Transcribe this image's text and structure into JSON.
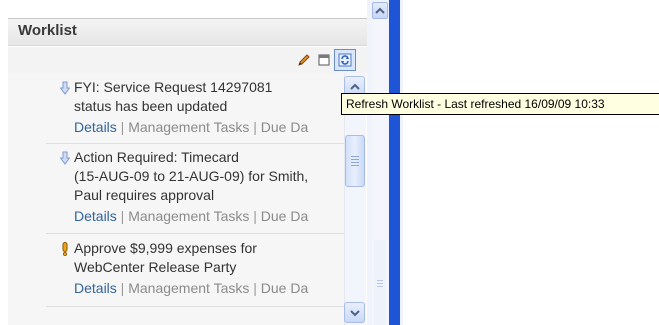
{
  "worklist": {
    "title": "Worklist",
    "toolbar": {
      "edit_icon": "pencil-icon",
      "window_icon": "window-icon",
      "refresh_icon": "refresh-icon"
    },
    "tooltip": "Refresh Worklist - Last refreshed 16/09/09 10:33",
    "items": [
      {
        "icon": "arrow-down-icon",
        "lines": [
          "FYI: Service Request 14297081",
          "status has been updated"
        ],
        "links": {
          "details": "Details",
          "sep1": " | ",
          "management": "Management Tasks",
          "sep2": " | ",
          "due": "Due Da"
        }
      },
      {
        "icon": "arrow-down-icon",
        "lines": [
          "Action Required: Timecard",
          "(15-AUG-09 to 21-AUG-09) for Smith,",
          "Paul requires approval"
        ],
        "links": {
          "details": "Details",
          "sep1": " | ",
          "management": "Management Tasks",
          "sep2": " | ",
          "due": "Due Da"
        }
      },
      {
        "icon": "exclamation-icon",
        "lines": [
          "Approve $9,999 expenses for",
          "WebCenter Release Party"
        ],
        "links": {
          "details": "Details",
          "sep1": " | ",
          "management": "Management Tasks",
          "sep2": " | ",
          "due": "Due Da"
        }
      }
    ]
  },
  "colors": {
    "accent_blue": "#1d55d6",
    "link_blue": "#34639b",
    "tooltip_bg": "#ffffe1"
  }
}
